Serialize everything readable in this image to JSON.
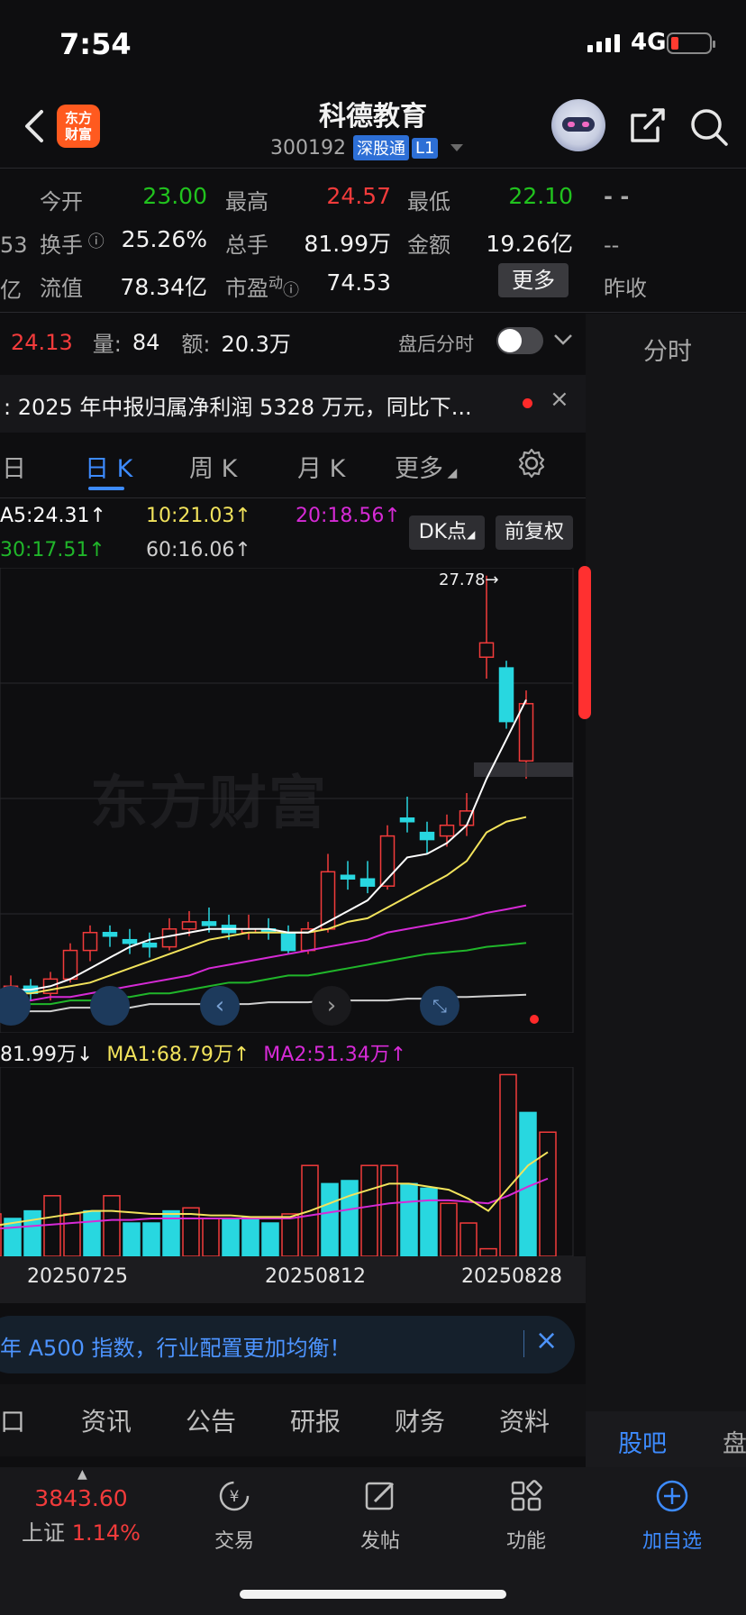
{
  "status_bar": {
    "time": "7:54",
    "network": "4G"
  },
  "header": {
    "app_logo_line1": "东方",
    "app_logo_line2": "财富",
    "stock_name": "科德教育",
    "stock_code": "300192",
    "tag_connect": "深股通",
    "tag_level": "L1"
  },
  "quote": {
    "open_label": "今开",
    "open_value": "23.00",
    "high_label": "最高",
    "high_value": "24.57",
    "low_label": "最低",
    "low_value": "22.10",
    "turnover_label": "换手",
    "turnover_value": "25.26%",
    "volume_label": "总手",
    "volume_value": "81.99万",
    "amount_label": "金额",
    "amount_value": "19.26亿",
    "float_cap_label": "流值",
    "float_cap_value": "78.34亿",
    "pe_label": "市盈",
    "pe_sup": "动",
    "pe_value": "74.53",
    "more_button": "更多",
    "prev_close_label": "昨收",
    "side_left_1": "53",
    "side_left_2": "亿",
    "side_right_1": "- -",
    "side_right_2": "--"
  },
  "after_hours": {
    "price": "24.13",
    "vol_label": "量:",
    "vol_value": "84",
    "amt_label": "额:",
    "amt_value": "20.3万",
    "toggle_label": "盘后分时"
  },
  "news": {
    "text": ":  2025 年中报归属净利润 5328 万元，同比下..."
  },
  "right_panel": {
    "tab_label": "分时",
    "bottom_tab_1": "股吧",
    "bottom_tab_2": "盘"
  },
  "kline_tabs": [
    "日",
    "日 K",
    "周 K",
    "月 K",
    "更多"
  ],
  "ma_legend": {
    "ma5": "A5:24.31↑",
    "ma10": "10:21.03↑",
    "ma20": "20:18.56↑",
    "ma30": "30:17.51↑",
    "ma60": "60:16.06↑"
  },
  "buttons": {
    "dk_point": "DK点",
    "adjust": "前复权"
  },
  "watermark": "东方财富",
  "max_label": "27.78→",
  "vol_legend": {
    "vol": "81.99万↓",
    "ma1": "MA1:68.79万↑",
    "ma2": "MA2:51.34万↑"
  },
  "date_ticks": [
    "20250725",
    "20250812",
    "20250828"
  ],
  "banner_text": "年 A500 指数，行业配置更加均衡！",
  "info_tabs": [
    "口",
    "资讯",
    "公告",
    "研报",
    "财务",
    "资料"
  ],
  "bottom_nav": {
    "index_value": "3843.60",
    "index_name": "上证",
    "index_change": "1.14%",
    "trade": "交易",
    "post": "发帖",
    "functions": "功能",
    "add_watch": "加自选"
  },
  "colors": {
    "up": "#f23b3b",
    "down": "#28d7e0",
    "ma5": "#ffffff",
    "ma10": "#f2e35c",
    "ma20": "#d62ad6",
    "ma30": "#20b62a",
    "ma60": "#cfcfcf",
    "accent": "#3d8bff"
  },
  "chart_data": {
    "type": "candlestick",
    "candles": [
      {
        "o": 16.0,
        "c": 16.3,
        "h": 16.6,
        "l": 15.8
      },
      {
        "o": 16.3,
        "c": 16.1,
        "h": 16.5,
        "l": 15.9
      },
      {
        "o": 16.1,
        "c": 16.5,
        "h": 16.7,
        "l": 15.9
      },
      {
        "o": 16.5,
        "c": 17.3,
        "h": 17.5,
        "l": 16.4
      },
      {
        "o": 17.3,
        "c": 17.8,
        "h": 18.0,
        "l": 17.0
      },
      {
        "o": 17.8,
        "c": 17.7,
        "h": 18.0,
        "l": 17.4
      },
      {
        "o": 17.6,
        "c": 17.5,
        "h": 17.9,
        "l": 17.2
      },
      {
        "o": 17.5,
        "c": 17.4,
        "h": 17.8,
        "l": 17.1
      },
      {
        "o": 17.4,
        "c": 17.9,
        "h": 18.2,
        "l": 17.3
      },
      {
        "o": 17.9,
        "c": 18.1,
        "h": 18.4,
        "l": 17.7
      },
      {
        "o": 18.1,
        "c": 18.0,
        "h": 18.5,
        "l": 17.8
      },
      {
        "o": 18.0,
        "c": 17.8,
        "h": 18.3,
        "l": 17.6
      },
      {
        "o": 17.8,
        "c": 17.9,
        "h": 18.3,
        "l": 17.6
      },
      {
        "o": 17.9,
        "c": 17.8,
        "h": 18.2,
        "l": 17.6
      },
      {
        "o": 17.8,
        "c": 17.3,
        "h": 18.0,
        "l": 17.2
      },
      {
        "o": 17.3,
        "c": 17.9,
        "h": 18.1,
        "l": 17.2
      },
      {
        "o": 17.9,
        "c": 19.5,
        "h": 20.0,
        "l": 17.8
      },
      {
        "o": 19.4,
        "c": 19.3,
        "h": 19.8,
        "l": 19.0
      },
      {
        "o": 19.3,
        "c": 19.1,
        "h": 19.8,
        "l": 18.9
      },
      {
        "o": 19.1,
        "c": 20.5,
        "h": 20.8,
        "l": 19.0
      },
      {
        "o": 21.0,
        "c": 20.9,
        "h": 21.6,
        "l": 20.6
      },
      {
        "o": 20.6,
        "c": 20.4,
        "h": 20.9,
        "l": 20.0
      },
      {
        "o": 20.5,
        "c": 20.8,
        "h": 21.1,
        "l": 20.2
      },
      {
        "o": 20.8,
        "c": 21.2,
        "h": 21.7,
        "l": 20.5
      },
      {
        "o": 25.5,
        "c": 25.9,
        "h": 27.78,
        "l": 24.9
      },
      {
        "o": 25.2,
        "c": 23.7,
        "h": 25.4,
        "l": 23.5
      },
      {
        "o": 22.6,
        "c": 24.2,
        "h": 24.57,
        "l": 22.1
      }
    ],
    "ma5": [
      16.2,
      16.2,
      16.3,
      16.5,
      16.8,
      17.1,
      17.4,
      17.6,
      17.7,
      17.8,
      17.9,
      17.9,
      17.9,
      17.9,
      17.8,
      17.8,
      18.1,
      18.4,
      18.7,
      19.3,
      19.9,
      20.0,
      20.3,
      20.8,
      22.1,
      23.2,
      24.31
    ],
    "ma10": [
      16.1,
      16.1,
      16.2,
      16.3,
      16.4,
      16.6,
      16.8,
      17.0,
      17.2,
      17.4,
      17.6,
      17.7,
      17.8,
      17.8,
      17.8,
      17.8,
      17.9,
      18.1,
      18.2,
      18.5,
      18.8,
      19.1,
      19.4,
      19.8,
      20.6,
      20.9,
      21.03
    ],
    "ma20": [
      15.9,
      15.9,
      16.0,
      16.0,
      16.1,
      16.2,
      16.3,
      16.4,
      16.5,
      16.6,
      16.8,
      16.9,
      17.0,
      17.1,
      17.2,
      17.3,
      17.4,
      17.5,
      17.6,
      17.8,
      17.9,
      18.0,
      18.1,
      18.2,
      18.35,
      18.45,
      18.56
    ],
    "ma30": [
      15.8,
      15.8,
      15.8,
      15.9,
      15.9,
      16.0,
      16.0,
      16.1,
      16.1,
      16.2,
      16.3,
      16.4,
      16.4,
      16.5,
      16.6,
      16.6,
      16.7,
      16.8,
      16.9,
      17.0,
      17.1,
      17.2,
      17.25,
      17.3,
      17.4,
      17.45,
      17.51
    ],
    "ma60": [
      15.6,
      15.6,
      15.6,
      15.7,
      15.7,
      15.7,
      15.7,
      15.8,
      15.8,
      15.8,
      15.8,
      15.8,
      15.8,
      15.85,
      15.85,
      15.85,
      15.9,
      15.9,
      15.9,
      15.9,
      15.95,
      15.95,
      16.0,
      16.0,
      16.02,
      16.04,
      16.06
    ],
    "ylim": [
      15.4,
      28.0
    ],
    "volume": [
      28,
      25,
      30,
      40,
      28,
      30,
      40,
      22,
      22,
      30,
      32,
      25,
      24,
      26,
      22,
      28,
      60,
      48,
      50,
      60,
      60,
      48,
      45,
      35,
      22,
      5,
      120,
      95,
      82
    ],
    "vol_up": [
      true,
      false,
      false,
      true,
      true,
      false,
      true,
      false,
      false,
      false,
      true,
      true,
      false,
      false,
      false,
      true,
      true,
      false,
      false,
      true,
      true,
      false,
      false,
      true,
      true,
      true,
      true,
      false,
      true
    ],
    "vol_ma1": [
      20,
      22,
      24,
      26,
      28,
      30,
      30,
      29,
      28,
      28,
      28,
      27,
      27,
      26,
      26,
      26,
      30,
      35,
      40,
      44,
      48,
      48,
      46,
      44,
      38,
      30,
      45,
      60,
      68.79
    ],
    "vol_ma2": [
      18,
      19,
      20,
      21,
      22,
      23,
      24,
      24,
      25,
      25,
      25,
      25,
      25,
      25,
      25,
      25,
      27,
      29,
      31,
      33,
      35,
      36,
      37,
      37,
      36,
      35,
      40,
      46,
      51.34
    ],
    "vol_ylim": [
      0,
      125
    ]
  }
}
